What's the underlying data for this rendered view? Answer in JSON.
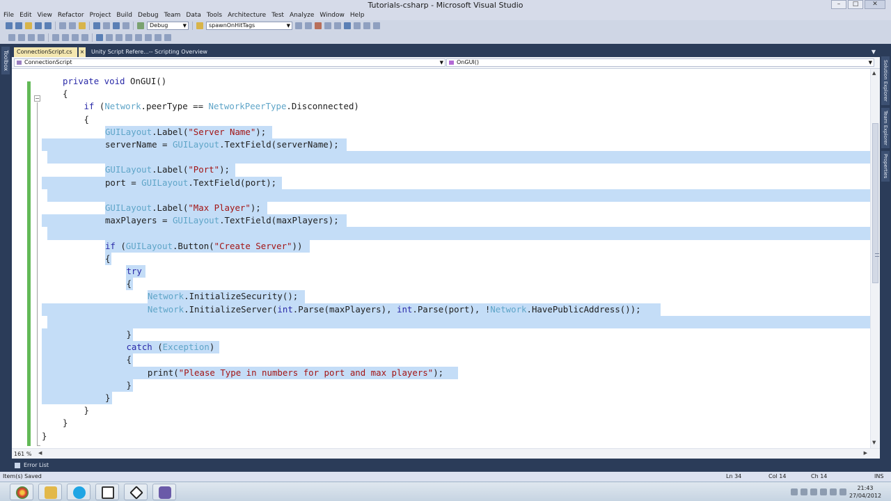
{
  "window": {
    "title": "Tutorials-csharp - Microsoft Visual Studio",
    "controls": [
      "–",
      "□",
      "✕"
    ]
  },
  "menu": [
    "File",
    "Edit",
    "View",
    "Refactor",
    "Project",
    "Build",
    "Debug",
    "Team",
    "Data",
    "Tools",
    "Architecture",
    "Test",
    "Analyze",
    "Window",
    "Help"
  ],
  "toolbar": {
    "config": "Debug",
    "find": "spawnOnHitTags"
  },
  "left_strip": {
    "toolbox_label": "Toolbox"
  },
  "right_strip": {
    "labels": [
      "Solution Explorer",
      "Team Explorer",
      "Properties"
    ]
  },
  "tabs": [
    {
      "label": "ConnectionScript.cs",
      "close": "×"
    },
    {
      "label": "Unity Script Refere...-- Scripting Overview"
    }
  ],
  "navbar": {
    "class": "ConnectionScript",
    "member": "OnGUI()"
  },
  "gutter": {
    "collapse": "−"
  },
  "code_lines": [
    [
      {
        "t": "private void ",
        "c": "kw"
      },
      {
        "t": "OnGUI()",
        "c": "pl"
      }
    ],
    [
      {
        "t": "{",
        "c": "pl"
      }
    ],
    [
      {
        "t": "if",
        "c": "kw"
      },
      {
        "t": " (",
        "c": "pl"
      },
      {
        "t": "Network",
        "c": "ty"
      },
      {
        "t": ".peerType == ",
        "c": "pl"
      },
      {
        "t": "NetworkPeerType",
        "c": "ty"
      },
      {
        "t": ".Disconnected)",
        "c": "pl"
      }
    ],
    [
      {
        "t": "{",
        "c": "pl"
      }
    ],
    [
      {
        "t": "GUILayout",
        "c": "ty"
      },
      {
        "t": ".Label(",
        "c": "pl"
      },
      {
        "t": "\"Server Name\"",
        "c": "st"
      },
      {
        "t": ");",
        "c": "pl"
      }
    ],
    [
      {
        "t": "serverName = ",
        "c": "pl"
      },
      {
        "t": "GUILayout",
        "c": "ty"
      },
      {
        "t": ".TextField(serverName);",
        "c": "pl"
      }
    ],
    [],
    [
      {
        "t": "GUILayout",
        "c": "ty"
      },
      {
        "t": ".Label(",
        "c": "pl"
      },
      {
        "t": "\"Port\"",
        "c": "st"
      },
      {
        "t": ");",
        "c": "pl"
      }
    ],
    [
      {
        "t": "port = ",
        "c": "pl"
      },
      {
        "t": "GUILayout",
        "c": "ty"
      },
      {
        "t": ".TextField(port);",
        "c": "pl"
      }
    ],
    [],
    [
      {
        "t": "GUILayout",
        "c": "ty"
      },
      {
        "t": ".Label(",
        "c": "pl"
      },
      {
        "t": "\"Max Player\"",
        "c": "st"
      },
      {
        "t": ");",
        "c": "pl"
      }
    ],
    [
      {
        "t": "maxPlayers = ",
        "c": "pl"
      },
      {
        "t": "GUILayout",
        "c": "ty"
      },
      {
        "t": ".TextField(maxPlayers);",
        "c": "pl"
      }
    ],
    [],
    [
      {
        "t": "if",
        "c": "kw"
      },
      {
        "t": " (",
        "c": "pl"
      },
      {
        "t": "GUILayout",
        "c": "ty"
      },
      {
        "t": ".Button(",
        "c": "pl"
      },
      {
        "t": "\"Create Server\"",
        "c": "st"
      },
      {
        "t": "))",
        "c": "pl"
      }
    ],
    [
      {
        "t": "{",
        "c": "pl"
      }
    ],
    [
      {
        "t": "try",
        "c": "kw"
      }
    ],
    [
      {
        "t": "{",
        "c": "pl"
      }
    ],
    [
      {
        "t": "Network",
        "c": "ty"
      },
      {
        "t": ".InitializeSecurity();",
        "c": "pl"
      }
    ],
    [
      {
        "t": "Network",
        "c": "ty"
      },
      {
        "t": ".InitializeServer(",
        "c": "pl"
      },
      {
        "t": "int",
        "c": "kw"
      },
      {
        "t": ".Parse(maxPlayers), ",
        "c": "pl"
      },
      {
        "t": "int",
        "c": "kw"
      },
      {
        "t": ".Parse(port), !",
        "c": "pl"
      },
      {
        "t": "Network",
        "c": "ty"
      },
      {
        "t": ".HavePublicAddress());",
        "c": "pl"
      }
    ],
    [],
    [
      {
        "t": "}",
        "c": "pl"
      }
    ],
    [
      {
        "t": "catch",
        "c": "kw"
      },
      {
        "t": " (",
        "c": "pl"
      },
      {
        "t": "Exception",
        "c": "ty"
      },
      {
        "t": ")",
        "c": "pl"
      }
    ],
    [
      {
        "t": "{",
        "c": "pl"
      }
    ],
    [
      {
        "t": "print(",
        "c": "pl"
      },
      {
        "t": "\"Please Type in numbers for port and max players\"",
        "c": "st"
      },
      {
        "t": ");",
        "c": "pl"
      }
    ],
    [
      {
        "t": "}",
        "c": "pl"
      }
    ],
    [
      {
        "t": "}",
        "c": "pl"
      }
    ],
    [
      {
        "t": "}",
        "c": "pl"
      }
    ],
    [
      {
        "t": "}",
        "c": "pl"
      }
    ],
    [
      {
        "t": "}",
        "c": "pl"
      }
    ]
  ],
  "editor": {
    "zoom": "161 %"
  },
  "error_list": {
    "label": "Error List"
  },
  "status": {
    "message": "Item(s) Saved",
    "ln": "Ln 34",
    "col": "Col 14",
    "ch": "Ch 14",
    "mode": "INS"
  },
  "taskbar": {
    "apps": [
      "chrome-icon",
      "explorer-icon",
      "skype-icon",
      "window-icon",
      "unity-icon",
      "visual-studio-icon"
    ],
    "time": "21:43",
    "date": "27/04/2012"
  }
}
